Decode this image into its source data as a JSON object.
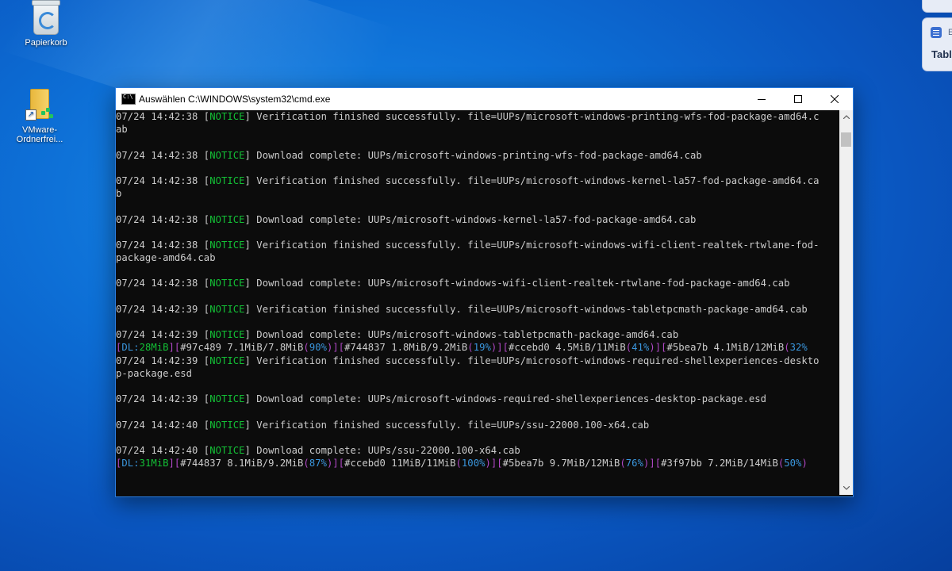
{
  "desktop": {
    "icons": [
      {
        "label": "Papierkorb",
        "icon": "recycle-bin-icon"
      },
      {
        "label": "VMware-Ordnerfrei...",
        "icon": "shared-folder-icon"
      }
    ],
    "widget": {
      "header_label": "E",
      "title": "Tabl"
    }
  },
  "window": {
    "title": "Auswählen C:\\WINDOWS\\system32\\cmd.exe",
    "controls": [
      "minimize",
      "maximize",
      "close"
    ]
  },
  "colors": {
    "notice": "#13c136",
    "bracket": "#b148c6",
    "percent": "#3a96dd",
    "text": "#cccccc",
    "background": "#0c0c0c"
  },
  "console": {
    "lines": [
      [
        {
          "t": "07/24 14:42:38 ["
        },
        {
          "t": "NOTICE",
          "c": "green"
        },
        {
          "t": "] Verification finished successfully. file=UUPs/microsoft-windows-printing-wfs-fod-package-amd64.c"
        }
      ],
      [
        {
          "t": "ab"
        }
      ],
      [],
      [
        {
          "t": "07/24 14:42:38 ["
        },
        {
          "t": "NOTICE",
          "c": "green"
        },
        {
          "t": "] Download complete: UUPs/microsoft-windows-printing-wfs-fod-package-amd64.cab"
        }
      ],
      [],
      [
        {
          "t": "07/24 14:42:38 ["
        },
        {
          "t": "NOTICE",
          "c": "green"
        },
        {
          "t": "] Verification finished successfully. file=UUPs/microsoft-windows-kernel-la57-fod-package-amd64.ca"
        }
      ],
      [
        {
          "t": "b"
        }
      ],
      [],
      [
        {
          "t": "07/24 14:42:38 ["
        },
        {
          "t": "NOTICE",
          "c": "green"
        },
        {
          "t": "] Download complete: UUPs/microsoft-windows-kernel-la57-fod-package-amd64.cab"
        }
      ],
      [],
      [
        {
          "t": "07/24 14:42:38 ["
        },
        {
          "t": "NOTICE",
          "c": "green"
        },
        {
          "t": "] Verification finished successfully. file=UUPs/microsoft-windows-wifi-client-realtek-rtwlane-fod-"
        }
      ],
      [
        {
          "t": "package-amd64.cab"
        }
      ],
      [],
      [
        {
          "t": "07/24 14:42:38 ["
        },
        {
          "t": "NOTICE",
          "c": "green"
        },
        {
          "t": "] Download complete: UUPs/microsoft-windows-wifi-client-realtek-rtwlane-fod-package-amd64.cab"
        }
      ],
      [],
      [
        {
          "t": "07/24 14:42:39 ["
        },
        {
          "t": "NOTICE",
          "c": "green"
        },
        {
          "t": "] Verification finished successfully. file=UUPs/microsoft-windows-tabletpcmath-package-amd64.cab"
        }
      ],
      [],
      [
        {
          "t": "07/24 14:42:39 ["
        },
        {
          "t": "NOTICE",
          "c": "green"
        },
        {
          "t": "] Download complete: UUPs/microsoft-windows-tabletpcmath-package-amd64.cab"
        }
      ],
      [
        {
          "t": "[",
          "c": "purple"
        },
        {
          "t": "DL:",
          "c": "blue"
        },
        {
          "t": "28MiB",
          "c": "green"
        },
        {
          "t": "][",
          "c": "purple"
        },
        {
          "t": "#97c489 7.1MiB/7.8MiB"
        },
        {
          "t": "(",
          "c": "purple"
        },
        {
          "t": "90%",
          "c": "blue"
        },
        {
          "t": ")][",
          "c": "purple"
        },
        {
          "t": "#744837 1.8MiB/9.2MiB"
        },
        {
          "t": "(",
          "c": "purple"
        },
        {
          "t": "19%",
          "c": "blue"
        },
        {
          "t": ")][",
          "c": "purple"
        },
        {
          "t": "#ccebd0 4.5MiB/11MiB"
        },
        {
          "t": "(",
          "c": "purple"
        },
        {
          "t": "41%",
          "c": "blue"
        },
        {
          "t": ")][",
          "c": "purple"
        },
        {
          "t": "#5bea7b 4.1MiB/12MiB"
        },
        {
          "t": "(",
          "c": "purple"
        },
        {
          "t": "32%",
          "c": "blue"
        }
      ],
      [
        {
          "t": "07/24 14:42:39 ["
        },
        {
          "t": "NOTICE",
          "c": "green"
        },
        {
          "t": "] Verification finished successfully. file=UUPs/microsoft-windows-required-shellexperiences-deskto"
        }
      ],
      [
        {
          "t": "p-package.esd"
        }
      ],
      [],
      [
        {
          "t": "07/24 14:42:39 ["
        },
        {
          "t": "NOTICE",
          "c": "green"
        },
        {
          "t": "] Download complete: UUPs/microsoft-windows-required-shellexperiences-desktop-package.esd"
        }
      ],
      [],
      [
        {
          "t": "07/24 14:42:40 ["
        },
        {
          "t": "NOTICE",
          "c": "green"
        },
        {
          "t": "] Verification finished successfully. file=UUPs/ssu-22000.100-x64.cab"
        }
      ],
      [],
      [
        {
          "t": "07/24 14:42:40 ["
        },
        {
          "t": "NOTICE",
          "c": "green"
        },
        {
          "t": "] Download complete: UUPs/ssu-22000.100-x64.cab"
        }
      ],
      [
        {
          "t": "[",
          "c": "purple"
        },
        {
          "t": "DL:",
          "c": "blue"
        },
        {
          "t": "31MiB",
          "c": "green"
        },
        {
          "t": "][",
          "c": "purple"
        },
        {
          "t": "#744837 8.1MiB/9.2MiB"
        },
        {
          "t": "(",
          "c": "purple"
        },
        {
          "t": "87%",
          "c": "blue"
        },
        {
          "t": ")][",
          "c": "purple"
        },
        {
          "t": "#ccebd0 11MiB/11MiB"
        },
        {
          "t": "(",
          "c": "purple"
        },
        {
          "t": "100%",
          "c": "blue"
        },
        {
          "t": ")][",
          "c": "purple"
        },
        {
          "t": "#5bea7b 9.7MiB/12MiB"
        },
        {
          "t": "(",
          "c": "purple"
        },
        {
          "t": "76%",
          "c": "blue"
        },
        {
          "t": ")][",
          "c": "purple"
        },
        {
          "t": "#3f97bb 7.2MiB/14MiB"
        },
        {
          "t": "(",
          "c": "purple"
        },
        {
          "t": "50%",
          "c": "blue"
        },
        {
          "t": ")",
          "c": "purple"
        }
      ]
    ]
  }
}
